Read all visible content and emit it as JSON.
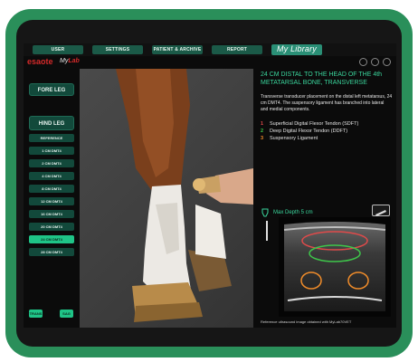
{
  "colors": {
    "device_frame": "#2a8f5a",
    "accent_green": "#3ad59c",
    "active_item": "#1fc487",
    "brand_red": "#d42a2a",
    "sdft": "#e04a4a",
    "ddft": "#3ec64a",
    "suspensory": "#f08c2a"
  },
  "nav": {
    "tabs": [
      "USER",
      "SETTINGS",
      "PATIENT & ARCHIVE",
      "REPORT"
    ],
    "active_tab": "My Library"
  },
  "brand": {
    "logo_text": "esaote",
    "product_prefix": "My",
    "product_suffix": "Lab"
  },
  "toolbar_icons": [
    "search-icon",
    "hierarchy-icon",
    "settings-icon"
  ],
  "left_panel": {
    "fore_leg": "FORE LEG",
    "hind_leg": "HIND LEG",
    "positions": [
      "REFERENCE",
      "1 CM DMT4",
      "2 CM DMT4",
      "4 CM DMT4",
      "8 CM DMT4",
      "12 CM DMT4",
      "16 CM DMT4",
      "20 CM DMT4",
      "24 CM DMT4",
      "28 CM DMT4"
    ],
    "active_position": "24 CM DMT4",
    "mode_buttons": [
      "TRANS",
      "SAG"
    ]
  },
  "info": {
    "title": "24 CM DISTAL TO THE HEAD OF THE 4th METATARSAL BONE, TRANSVERSE",
    "description": "Transverse transducer placement on the distal left metatarsus, 24 cm DMT4. The suspensory ligament has branched into lateral and medial components.",
    "legend": [
      {
        "num": "1",
        "label": "Superficial Digital Flexor Tendon (SDFT)"
      },
      {
        "num": "2",
        "label": "Deep Digital Flexor Tendon (DDFT)"
      },
      {
        "num": "3",
        "label": "Suspensory Ligament"
      }
    ]
  },
  "depth_label": "Max Depth 5 cm",
  "ultrasound_caption": "Reference ultrasound image obtained with MyLab70VET"
}
